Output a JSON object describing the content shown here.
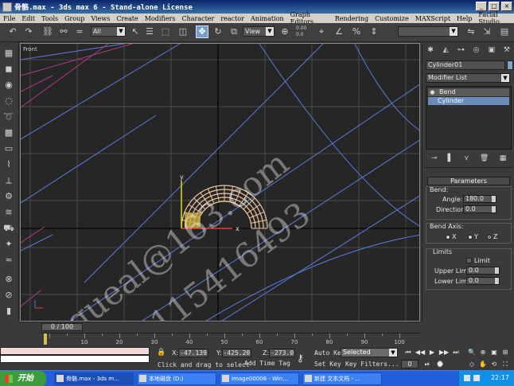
{
  "window": {
    "title": "骨骼.max - 3ds max 6 - Stand-alone License",
    "buttons": [
      "_",
      "□",
      "×"
    ]
  },
  "menu": [
    "File",
    "Edit",
    "Tools",
    "Group",
    "Views",
    "Create",
    "Modifiers",
    "Character",
    "reactor",
    "Animation",
    "Graph Editors",
    "Rendering",
    "Customize",
    "MAXScript",
    "Help",
    "Facial Studio"
  ],
  "toolbar": {
    "selection_filter": "All",
    "ref_coord": "View",
    "spinner_top": "0.00",
    "spinner_bottom": "0.0"
  },
  "viewport": {
    "label": "Front",
    "axis_y": "y",
    "axis_x": "x",
    "accent_wire": "#f0c8a0",
    "grid_color": "#4a4a4a"
  },
  "command_panel": {
    "object_name": "Cylinder01",
    "object_color": "#7ea2c8",
    "modifier_list": "Modifier List",
    "stack": [
      "Bend",
      "Cylinder"
    ],
    "parameters_title": "Parameters",
    "bend_group": "Bend:",
    "angle_label": "Angle:",
    "angle_value": "180.0",
    "direction_label": "Direction:",
    "direction_value": "0.0",
    "bend_axis_group": "Bend Axis:",
    "axis_options": [
      "X",
      "Y",
      "Z"
    ],
    "axis_selected": "Z",
    "limits_group": "Limits",
    "limit_checkbox": "Limit",
    "upper_limit_label": "Upper Limit:",
    "upper_limit_value": "0.0",
    "lower_limit_label": "Lower Limit:",
    "lower_limit_value": "0.0"
  },
  "timeline": {
    "frame_display": "0 / 100",
    "ticks": [
      "10",
      "20",
      "30",
      "40",
      "50",
      "60",
      "70",
      "80",
      "90",
      "100"
    ]
  },
  "status": {
    "x_label": "X:",
    "x_value": "-47.139",
    "y_label": "Y:",
    "y_value": "-425.20",
    "z_label": "Z:",
    "z_value": "-273.0",
    "prompt": "Click and drag to select",
    "add_time_tag": "Add Time Tag",
    "auto_key": "Auto Key",
    "set_key": "Set Key",
    "key_mode_selected": "Selected",
    "key_filters": "Key Filters...",
    "current_frame": "0"
  },
  "taskbar": {
    "start": "开始",
    "tasks": [
      "骨骼.max - 3ds m...",
      "本地磁盘 (D:)",
      "Image00006 - Win...",
      "新建 文本文档 - ..."
    ],
    "clock": "22:17"
  },
  "watermark": {
    "line1": "squeal@163.com",
    "line2": "QQ:115416493"
  }
}
